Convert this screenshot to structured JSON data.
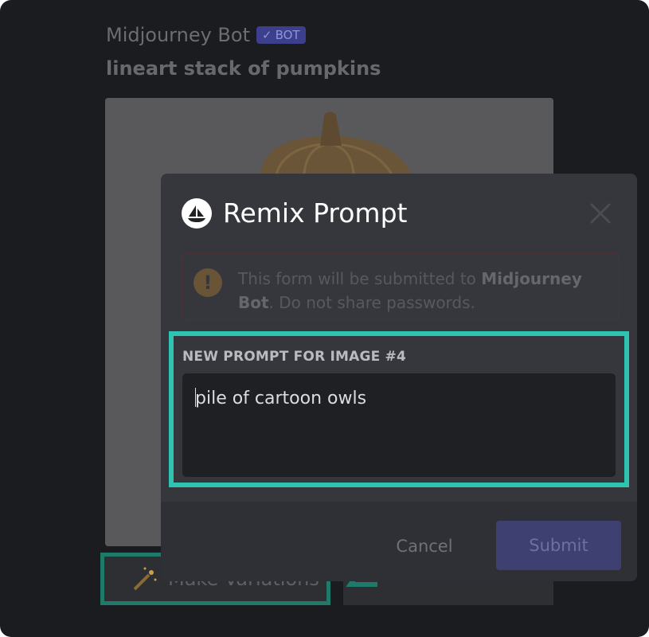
{
  "message": {
    "author": "Midjourney Bot",
    "badge": "BOT",
    "text": "lineart stack of pumpkins",
    "image_alt": "pumpkin-stack-image",
    "action_button": "Make Variations"
  },
  "modal": {
    "title": "Remix Prompt",
    "warning_prefix": "This form will be submitted to ",
    "warning_bot": "Midjourney Bot",
    "warning_suffix": ". Do not share passwords.",
    "field_label": "NEW PROMPT FOR IMAGE #4",
    "field_value": "pile of cartoon owls",
    "cancel_label": "Cancel",
    "submit_label": "Submit"
  },
  "colors": {
    "highlight": "#2fc4b2",
    "modal_bg": "#36373c",
    "submit_bg": "#3d4070"
  },
  "icons": [
    "checkmark-icon",
    "midjourney-logo-icon",
    "close-icon",
    "warning-icon",
    "magic-wand-icon",
    "arrow-icon"
  ]
}
